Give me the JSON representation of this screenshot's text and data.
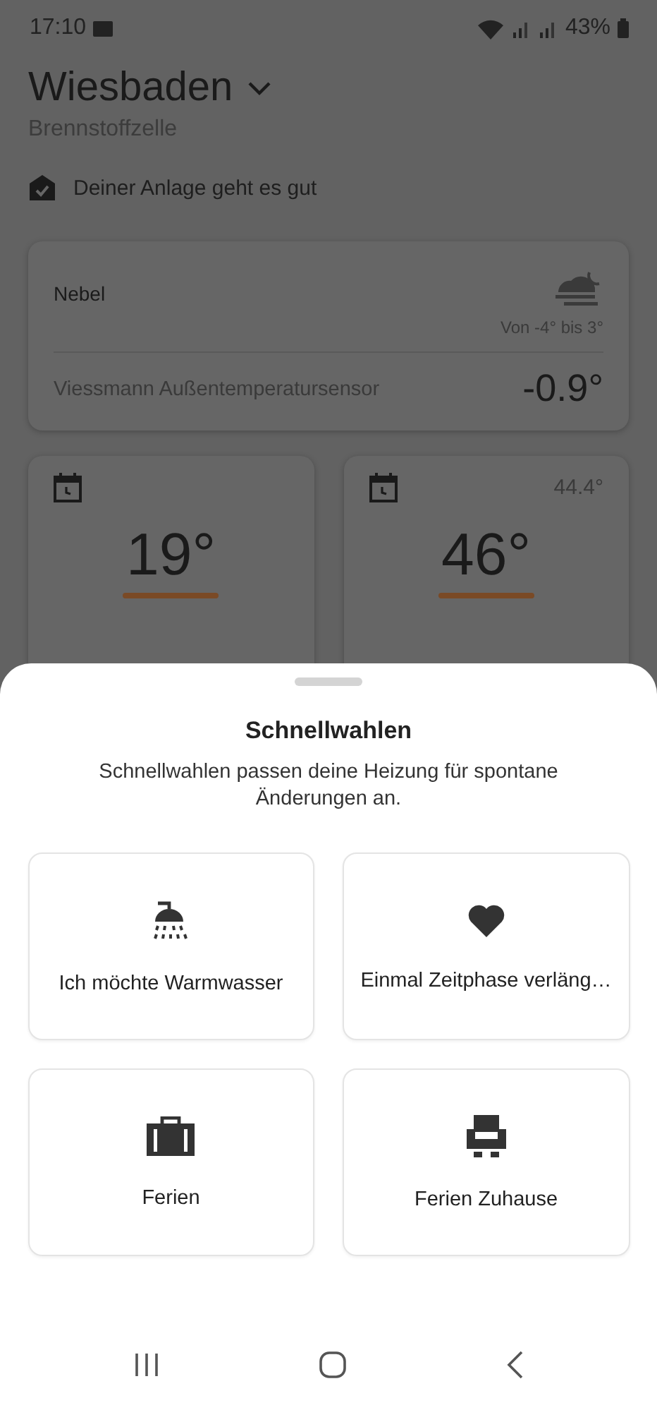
{
  "status_bar": {
    "time": "17:10",
    "battery": "43%"
  },
  "header": {
    "title": "Wiesbaden",
    "subtitle": "Brennstoffzelle"
  },
  "status_message": "Deiner Anlage geht es gut",
  "weather": {
    "condition": "Nebel",
    "range": "Von -4° bis 3°",
    "sensor_label": "Viessmann Außentemperatursensor",
    "sensor_value": "-0.9°"
  },
  "tiles": [
    {
      "value": "19°"
    },
    {
      "reading": "44.4°",
      "value": "46°"
    }
  ],
  "sheet": {
    "title": "Schnellwahlen",
    "description": "Schnellwahlen passen deine Heizung für spontane Änderungen an.",
    "actions": [
      {
        "kind": "shower",
        "label": "Ich möchte Warmwasser"
      },
      {
        "kind": "heart",
        "label": "Einmal Zeitphase verläng…"
      },
      {
        "kind": "suitcase",
        "label": "Ferien"
      },
      {
        "kind": "armchair",
        "label": "Ferien Zuhause"
      }
    ]
  }
}
